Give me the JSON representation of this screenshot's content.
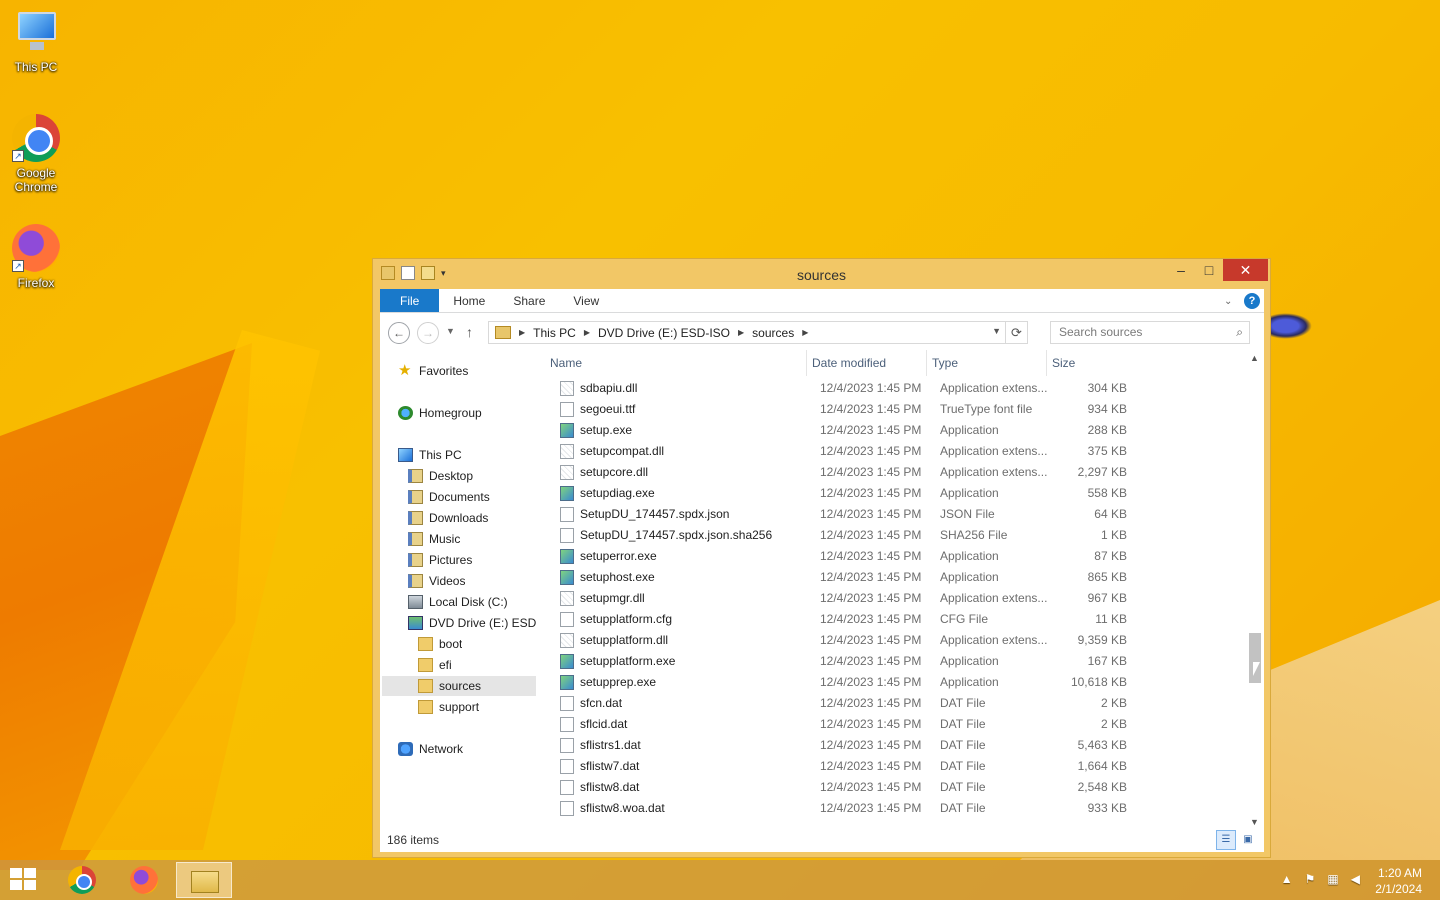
{
  "desktop": {
    "icons": [
      {
        "label": "This PC",
        "icon": "this-pc-icon"
      },
      {
        "label": "Google Chrome",
        "icon": "chrome-icon"
      },
      {
        "label": "Firefox",
        "icon": "firefox-icon"
      }
    ]
  },
  "window": {
    "title": "sources",
    "ribbon": {
      "tabs": [
        "File",
        "Home",
        "Share",
        "View"
      ]
    },
    "address": {
      "crumbs": [
        "This PC",
        "DVD Drive (E:) ESD-ISO",
        "sources"
      ]
    },
    "search": {
      "placeholder": "Search sources"
    },
    "nav": {
      "items": [
        {
          "label": "Favorites",
          "icon": "star-icon"
        },
        {
          "label": "Homegroup",
          "icon": "homegroup-icon"
        },
        {
          "label": "This PC",
          "icon": "this-pc-icon"
        },
        {
          "label": "Desktop",
          "icon": "folder-icon"
        },
        {
          "label": "Documents",
          "icon": "library-icon"
        },
        {
          "label": "Downloads",
          "icon": "library-icon"
        },
        {
          "label": "Music",
          "icon": "library-icon"
        },
        {
          "label": "Pictures",
          "icon": "library-icon"
        },
        {
          "label": "Videos",
          "icon": "library-icon"
        },
        {
          "label": "Local Disk (C:)",
          "icon": "disk-icon"
        },
        {
          "label": "DVD Drive (E:) ESD-ISO",
          "icon": "dvd-icon"
        },
        {
          "label": "boot",
          "icon": "folder-icon"
        },
        {
          "label": "efi",
          "icon": "folder-icon"
        },
        {
          "label": "sources",
          "icon": "folder-icon"
        },
        {
          "label": "support",
          "icon": "folder-icon"
        },
        {
          "label": "Network",
          "icon": "network-icon"
        }
      ]
    },
    "columns": {
      "name": "Name",
      "date": "Date modified",
      "type": "Type",
      "size": "Size"
    },
    "files": [
      {
        "name": "sdbapiu.dll",
        "date": "12/4/2023 1:45 PM",
        "type": "Application extens...",
        "size": "304 KB",
        "kind": "dll"
      },
      {
        "name": "segoeui.ttf",
        "date": "12/4/2023 1:45 PM",
        "type": "TrueType font file",
        "size": "934 KB",
        "kind": "font"
      },
      {
        "name": "setup.exe",
        "date": "12/4/2023 1:45 PM",
        "type": "Application",
        "size": "288 KB",
        "kind": "exe"
      },
      {
        "name": "setupcompat.dll",
        "date": "12/4/2023 1:45 PM",
        "type": "Application extens...",
        "size": "375 KB",
        "kind": "dll"
      },
      {
        "name": "setupcore.dll",
        "date": "12/4/2023 1:45 PM",
        "type": "Application extens...",
        "size": "2,297 KB",
        "kind": "dll"
      },
      {
        "name": "setupdiag.exe",
        "date": "12/4/2023 1:45 PM",
        "type": "Application",
        "size": "558 KB",
        "kind": "exe"
      },
      {
        "name": "SetupDU_174457.spdx.json",
        "date": "12/4/2023 1:45 PM",
        "type": "JSON File",
        "size": "64 KB",
        "kind": "file"
      },
      {
        "name": "SetupDU_174457.spdx.json.sha256",
        "date": "12/4/2023 1:45 PM",
        "type": "SHA256 File",
        "size": "1 KB",
        "kind": "file"
      },
      {
        "name": "setuperror.exe",
        "date": "12/4/2023 1:45 PM",
        "type": "Application",
        "size": "87 KB",
        "kind": "exe"
      },
      {
        "name": "setuphost.exe",
        "date": "12/4/2023 1:45 PM",
        "type": "Application",
        "size": "865 KB",
        "kind": "exe"
      },
      {
        "name": "setupmgr.dll",
        "date": "12/4/2023 1:45 PM",
        "type": "Application extens...",
        "size": "967 KB",
        "kind": "dll"
      },
      {
        "name": "setupplatform.cfg",
        "date": "12/4/2023 1:45 PM",
        "type": "CFG File",
        "size": "11 KB",
        "kind": "file"
      },
      {
        "name": "setupplatform.dll",
        "date": "12/4/2023 1:45 PM",
        "type": "Application extens...",
        "size": "9,359 KB",
        "kind": "dll"
      },
      {
        "name": "setupplatform.exe",
        "date": "12/4/2023 1:45 PM",
        "type": "Application",
        "size": "167 KB",
        "kind": "exe"
      },
      {
        "name": "setupprep.exe",
        "date": "12/4/2023 1:45 PM",
        "type": "Application",
        "size": "10,618 KB",
        "kind": "exe"
      },
      {
        "name": "sfcn.dat",
        "date": "12/4/2023 1:45 PM",
        "type": "DAT File",
        "size": "2 KB",
        "kind": "file"
      },
      {
        "name": "sflcid.dat",
        "date": "12/4/2023 1:45 PM",
        "type": "DAT File",
        "size": "2 KB",
        "kind": "file"
      },
      {
        "name": "sflistrs1.dat",
        "date": "12/4/2023 1:45 PM",
        "type": "DAT File",
        "size": "5,463 KB",
        "kind": "file"
      },
      {
        "name": "sflistw7.dat",
        "date": "12/4/2023 1:45 PM",
        "type": "DAT File",
        "size": "1,664 KB",
        "kind": "file"
      },
      {
        "name": "sflistw8.dat",
        "date": "12/4/2023 1:45 PM",
        "type": "DAT File",
        "size": "2,548 KB",
        "kind": "file"
      },
      {
        "name": "sflistw8.woa.dat",
        "date": "12/4/2023 1:45 PM",
        "type": "DAT File",
        "size": "933 KB",
        "kind": "file"
      }
    ],
    "status": {
      "items": "186 items"
    }
  },
  "taskbar": {
    "apps": [
      "start-icon",
      "chrome-icon",
      "firefox-icon",
      "file-explorer-icon"
    ],
    "clock": {
      "time": "1:20 AM",
      "date": "2/1/2024"
    }
  }
}
